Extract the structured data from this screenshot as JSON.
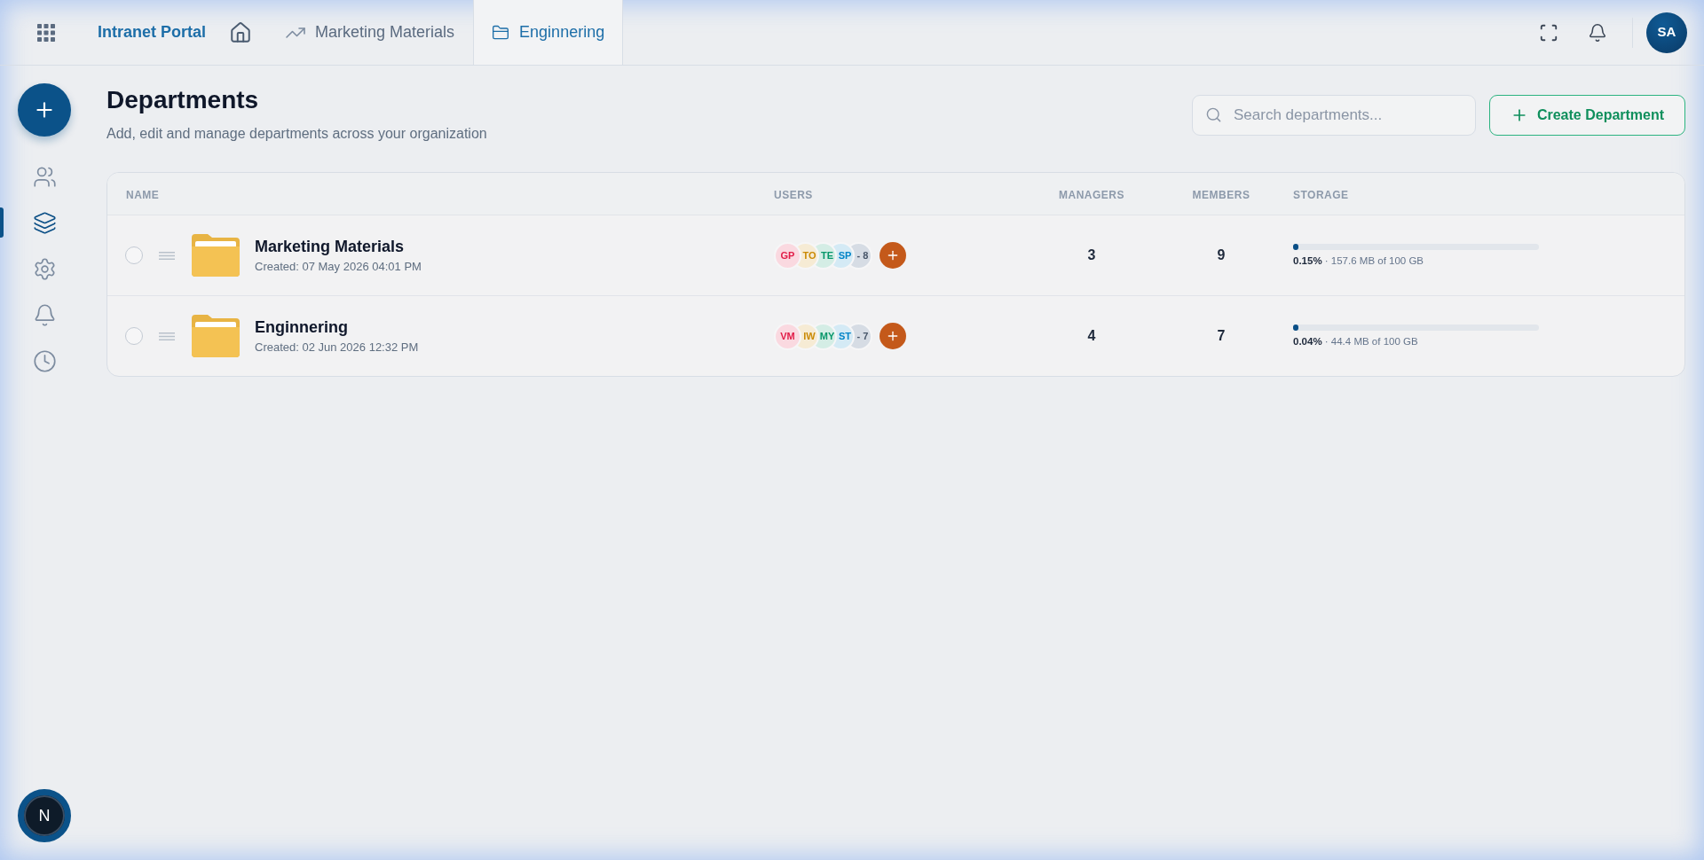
{
  "top_bar": {
    "brand": "Intranet Portal",
    "tabs": [
      {
        "label": "Marketing Materials",
        "kind": "trend",
        "selected": false
      },
      {
        "label": "Enginnering",
        "kind": "folder",
        "selected": true
      }
    ],
    "avatar": "SA"
  },
  "sidebar": {
    "items": [
      {
        "kind": "users",
        "selected": false
      },
      {
        "kind": "layers",
        "selected": true
      },
      {
        "kind": "settings",
        "selected": false
      },
      {
        "kind": "bell",
        "selected": false
      },
      {
        "kind": "clock",
        "selected": false
      }
    ],
    "dev_badge": "N"
  },
  "header": {
    "title": "Departments",
    "subtitle": "Add, edit and manage departments across your organization",
    "search": {
      "placeholder": "Search departments..."
    },
    "create_button": "Create Department"
  },
  "table": {
    "columns": [
      "NAME",
      "USERS",
      "MANAGERS",
      "MEMBERS",
      "STORAGE"
    ],
    "rows": [
      {
        "checked": false,
        "name": "Marketing Materials",
        "created": "Created: 07 May 2026 04:01 PM",
        "users": [
          {
            "initials": "GP",
            "color": "#e11d48"
          },
          {
            "initials": "TO",
            "color": "#ca8a04"
          },
          {
            "initials": "TE",
            "color": "#059669"
          },
          {
            "initials": "SP",
            "color": "#0284c7"
          }
        ],
        "more": "- 8",
        "managers": "3",
        "members": "9",
        "storage": {
          "level": 0.0015,
          "usage": "**0.15%** · 157.6 MB of 100 GB"
        }
      },
      {
        "checked": false,
        "name": "Enginnering",
        "created": "Created: 02 Jun 2026 12:32 PM",
        "users": [
          {
            "initials": "VM",
            "color": "#e11d48"
          },
          {
            "initials": "IW",
            "color": "#ca8a04"
          },
          {
            "initials": "MY",
            "color": "#059669"
          },
          {
            "initials": "ST",
            "color": "#0284c7"
          }
        ],
        "more": "- 7",
        "managers": "4",
        "members": "7",
        "storage": {
          "level": 0.0004,
          "usage": "**0.04%** · 44.4 MB of 100 GB"
        }
      }
    ]
  }
}
